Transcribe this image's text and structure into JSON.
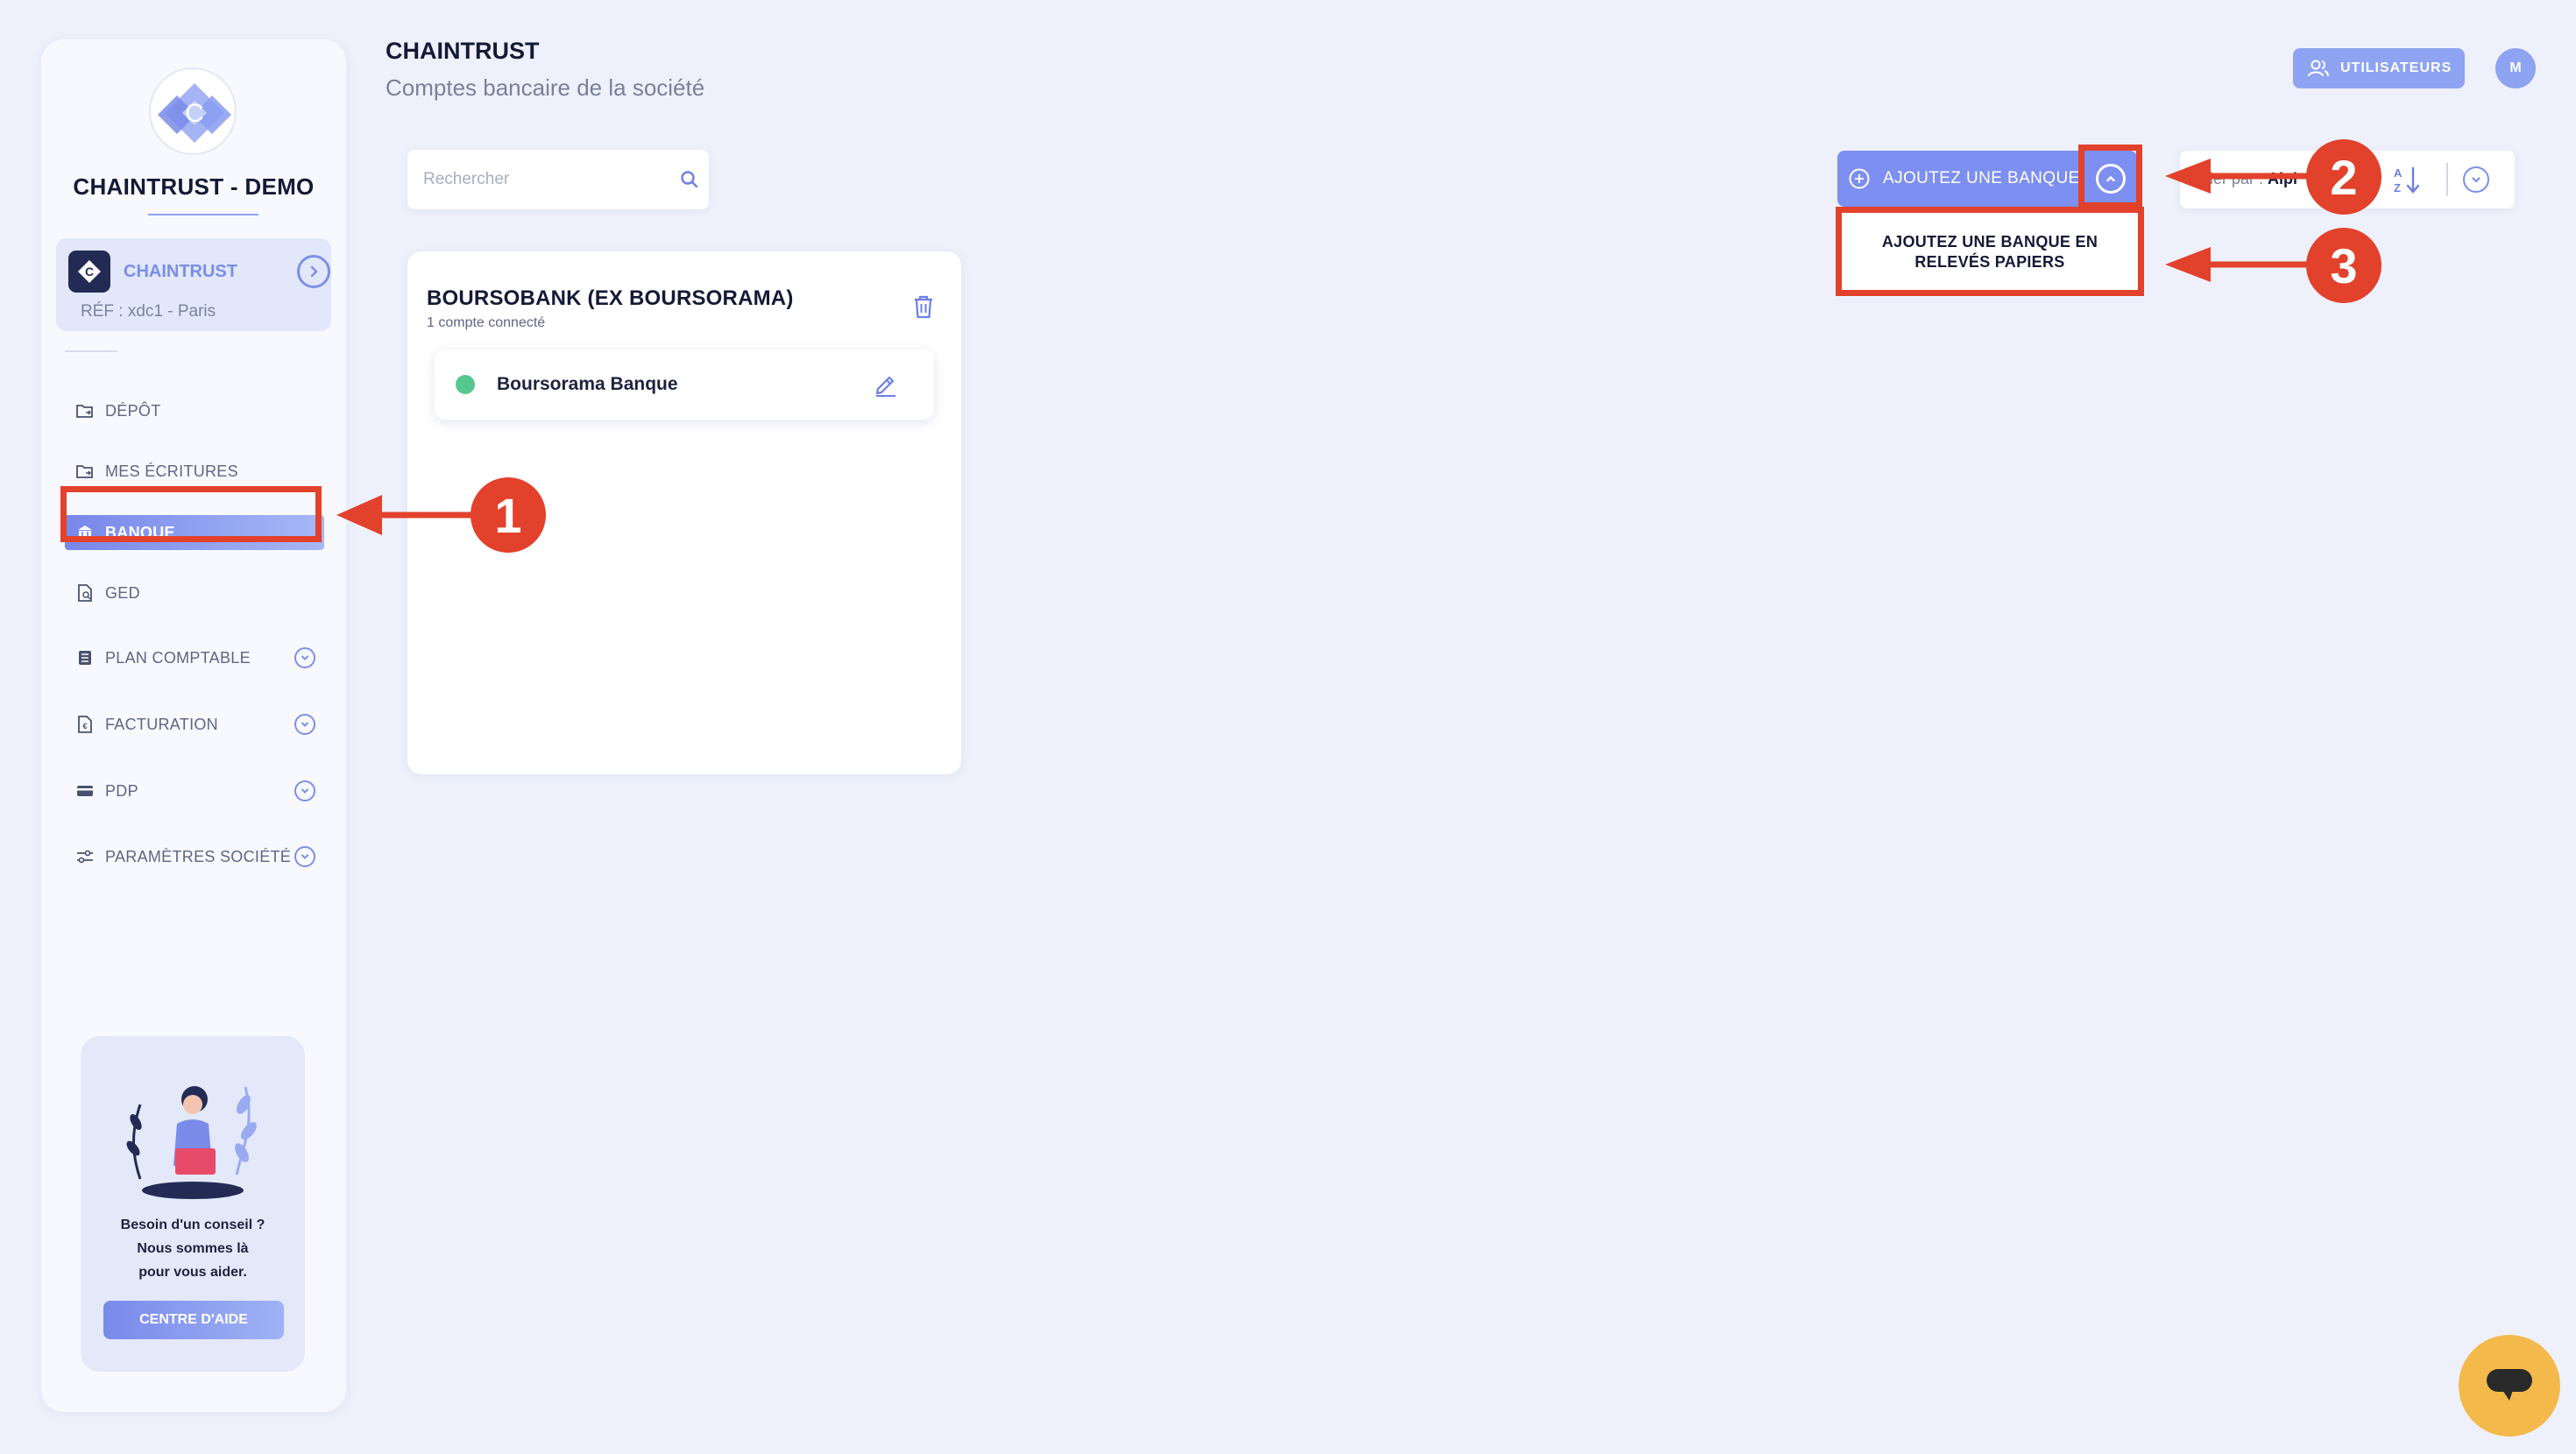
{
  "sidebar": {
    "company_name": "CHAINTRUST - DEMO",
    "company_card": {
      "title": "CHAINTRUST",
      "ref": "RÉF : xdc1 - Paris"
    },
    "nav_items": [
      {
        "label": "DÉPÔT",
        "icon": "folder-sync-icon",
        "has_chevron": false
      },
      {
        "label": "MES ÉCRITURES",
        "icon": "folder-sync-icon",
        "has_chevron": false
      },
      {
        "label": "BANQUE",
        "icon": "bank-icon",
        "has_chevron": false,
        "active": true
      },
      {
        "label": "GED",
        "icon": "document-search-icon",
        "has_chevron": false
      },
      {
        "label": "PLAN COMPTABLE",
        "icon": "ledger-icon",
        "has_chevron": true
      },
      {
        "label": "FACTURATION",
        "icon": "invoice-icon",
        "has_chevron": true
      },
      {
        "label": "PDP",
        "icon": "card-icon",
        "has_chevron": true
      },
      {
        "label": "PARAMÈTRES SOCIÉTÉ",
        "icon": "sliders-icon",
        "has_chevron": true
      }
    ],
    "help": {
      "line1": "Besoin d'un conseil ?",
      "line2": "Nous sommes là",
      "line3": "pour vous aider.",
      "button": "CENTRE D'AIDE"
    }
  },
  "header": {
    "title": "CHAINTRUST",
    "subtitle": "Comptes bancaire de la société",
    "users_button": "UTILISATEURS",
    "avatar_initial": "M"
  },
  "search": {
    "placeholder": "Rechercher",
    "value": ""
  },
  "bank_card": {
    "name": "BOURSOBANK (EX BOURSORAMA)",
    "count_text": "1 compte connecté",
    "accounts": [
      {
        "name": "Boursorama Banque",
        "status": "connected"
      }
    ]
  },
  "actions": {
    "add_bank_label": "AJOUTEZ UNE BANQUE",
    "dropdown_option_line1": "AJOUTEZ UNE BANQUE EN",
    "dropdown_option_line2": "RELEVÉS PAPIERS",
    "sort_prefix": "rier par : ",
    "sort_value": "Alpi"
  },
  "annotations": {
    "badge1": "1",
    "badge2": "2",
    "badge3": "3"
  },
  "colors": {
    "accent": "#7d8ff0",
    "annotation": "#e2412b",
    "status_connected": "#56c78f",
    "background": "#eef1fb"
  }
}
